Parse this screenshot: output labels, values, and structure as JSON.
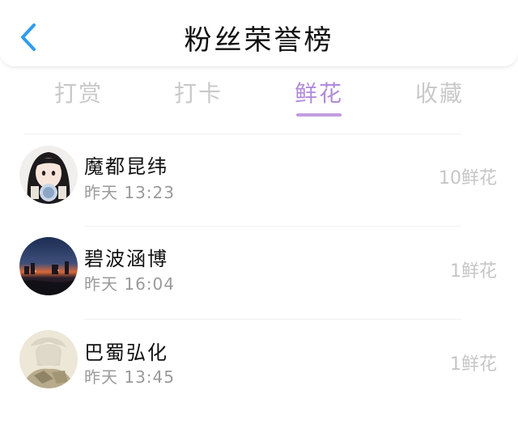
{
  "header": {
    "title": "粉丝荣誉榜",
    "back_icon": "chevron-left-icon",
    "accent_color": "#2f9bf0"
  },
  "tabs": [
    {
      "label": "打赏",
      "active": false
    },
    {
      "label": "打卡",
      "active": false
    },
    {
      "label": "鲜花",
      "active": true
    },
    {
      "label": "收藏",
      "active": false
    }
  ],
  "active_tab_color": "#b18ad8",
  "list": [
    {
      "name": "魔都昆纬",
      "time": "昨天 13:23",
      "amount": "10鲜花",
      "avatar": "avatar-girl"
    },
    {
      "name": "碧波涵博",
      "time": "昨天 16:04",
      "amount": "1鲜花",
      "avatar": "avatar-night-city"
    },
    {
      "name": "巴蜀弘化",
      "time": "昨天 13:45",
      "amount": "1鲜花",
      "avatar": "avatar-anime"
    }
  ]
}
